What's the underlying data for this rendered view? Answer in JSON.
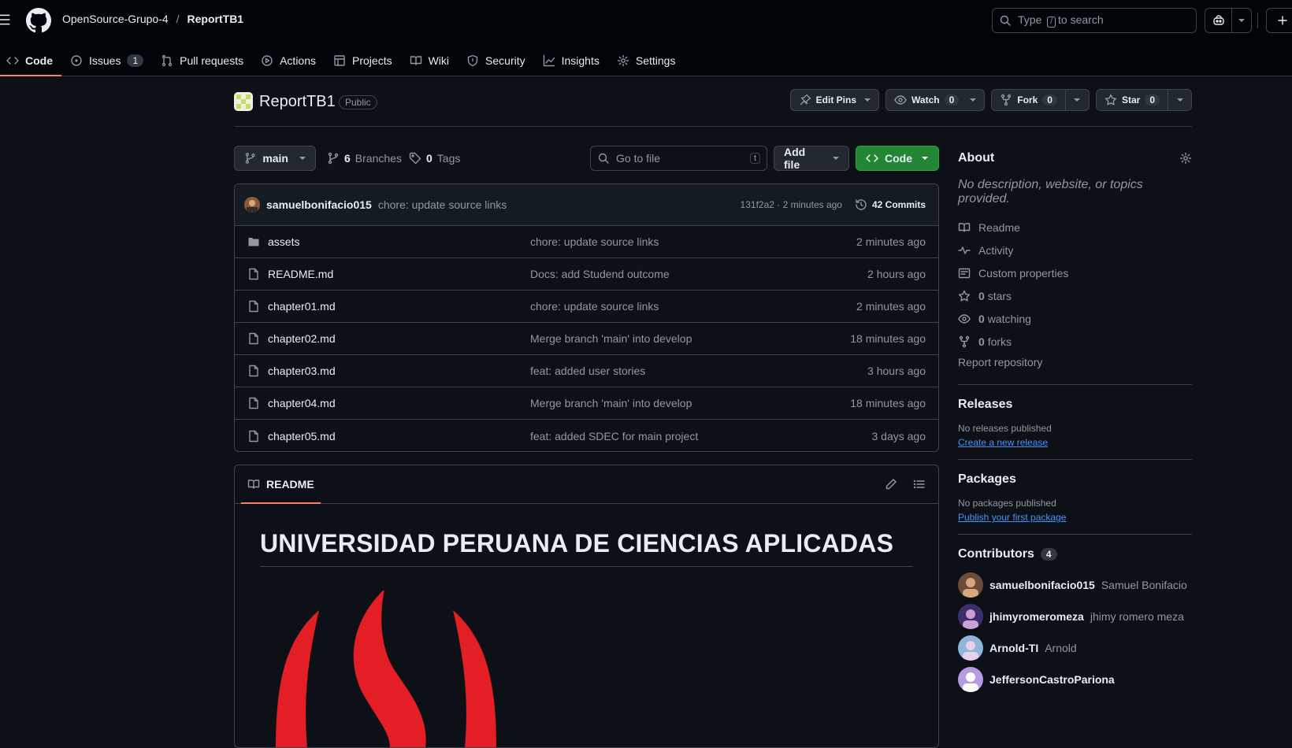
{
  "header": {
    "owner": "OpenSource-Grupo-4",
    "separator": "/",
    "repo": "ReportTB1",
    "search_prefix": "Type",
    "search_key": "/",
    "search_suffix": "to search"
  },
  "tabs": [
    {
      "label": "Code",
      "icon": "code-icon"
    },
    {
      "label": "Issues",
      "icon": "issue-icon",
      "count": "1"
    },
    {
      "label": "Pull requests",
      "icon": "pull-request-icon"
    },
    {
      "label": "Actions",
      "icon": "play-icon"
    },
    {
      "label": "Projects",
      "icon": "table-icon"
    },
    {
      "label": "Wiki",
      "icon": "book-icon"
    },
    {
      "label": "Security",
      "icon": "shield-icon"
    },
    {
      "label": "Insights",
      "icon": "graph-icon"
    },
    {
      "label": "Settings",
      "icon": "gear-icon"
    }
  ],
  "repohead": {
    "name": "ReportTB1",
    "visibility": "Public",
    "edit_pins": "Edit Pins",
    "watch": "Watch",
    "watch_count": "0",
    "fork": "Fork",
    "fork_count": "0",
    "star": "Star",
    "star_count": "0"
  },
  "branchbar": {
    "branch": "main",
    "branches_count": "6",
    "branches_label": "Branches",
    "tags_count": "0",
    "tags_label": "Tags",
    "goto_placeholder": "Go to file",
    "goto_key": "t",
    "add_file": "Add file",
    "code": "Code"
  },
  "latest_commit": {
    "author": "samuelbonifacio015",
    "message": "chore: update source links",
    "meta": "131f2a2 · 2 minutes ago",
    "commits": "42 Commits"
  },
  "files": [
    {
      "name": "assets",
      "type": "folder",
      "message": "chore: update source links",
      "date": "2 minutes ago"
    },
    {
      "name": "README.md",
      "type": "file",
      "message": "Docs: add Studend outcome",
      "date": "2 hours ago"
    },
    {
      "name": "chapter01.md",
      "type": "file",
      "message": "chore: update source links",
      "date": "2 minutes ago"
    },
    {
      "name": "chapter02.md",
      "type": "file",
      "message": "Merge branch 'main' into develop",
      "date": "18 minutes ago"
    },
    {
      "name": "chapter03.md",
      "type": "file",
      "message": "feat: added user stories",
      "date": "3 hours ago"
    },
    {
      "name": "chapter04.md",
      "type": "file",
      "message": "Merge branch 'main' into develop",
      "date": "18 minutes ago"
    },
    {
      "name": "chapter05.md",
      "type": "file",
      "message": "feat: added SDEC for main project",
      "date": "3 days ago"
    }
  ],
  "readme": {
    "tab": "README",
    "heading": "UNIVERSIDAD PERUANA DE CIENCIAS APLICADAS"
  },
  "about": {
    "title": "About",
    "description": "No description, website, or topics provided.",
    "links": [
      {
        "icon": "book-icon",
        "label": "Readme"
      },
      {
        "icon": "pulse-icon",
        "label": "Activity"
      },
      {
        "icon": "note-icon",
        "label": "Custom properties"
      },
      {
        "icon": "star-icon",
        "count": "0",
        "label": "stars"
      },
      {
        "icon": "eye-icon",
        "count": "0",
        "label": "watching"
      },
      {
        "icon": "fork-icon",
        "count": "0",
        "label": "forks"
      }
    ],
    "report": "Report repository"
  },
  "releases": {
    "title": "Releases",
    "empty": "No releases published",
    "link": "Create a new release"
  },
  "packages": {
    "title": "Packages",
    "empty": "No packages published",
    "link": "Publish your first package"
  },
  "contributors": {
    "title": "Contributors",
    "count": "4",
    "list": [
      {
        "login": "samuelbonifacio015",
        "name": "Samuel Bonifacio"
      },
      {
        "login": "jhimyromeromeza",
        "name": "jhimy romero meza"
      },
      {
        "login": "Arnold-TI",
        "name": "Arnold"
      },
      {
        "login": "JeffersonCastroPariona",
        "name": ""
      }
    ]
  },
  "colors": {
    "accent": "#238636",
    "tab_underline": "#f78166",
    "link": "#4493f8",
    "upc_red": "#e31e24"
  }
}
